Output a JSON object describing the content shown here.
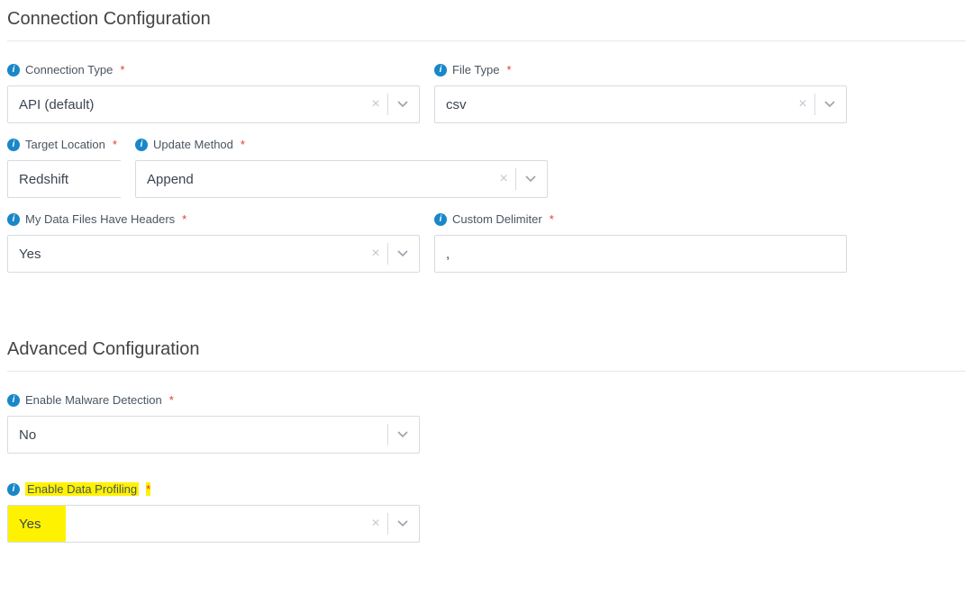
{
  "sections": {
    "connection": "Connection Configuration",
    "advanced": "Advanced Configuration"
  },
  "fields": {
    "connection_type": {
      "label": "Connection Type",
      "value": "API (default)"
    },
    "file_type": {
      "label": "File Type",
      "value": "csv"
    },
    "target_location": {
      "label": "Target Location",
      "value": "Redshift"
    },
    "update_method": {
      "label": "Update Method",
      "value": "Append"
    },
    "has_headers": {
      "label": "My Data Files Have Headers",
      "value": "Yes"
    },
    "custom_delimiter": {
      "label": "Custom Delimiter",
      "value": ","
    },
    "malware": {
      "label": "Enable Malware Detection",
      "value": "No"
    },
    "profiling": {
      "label": "Enable Data Profiling",
      "value": "Yes"
    }
  },
  "glyphs": {
    "required": "*",
    "info": "i",
    "clear": "×"
  }
}
